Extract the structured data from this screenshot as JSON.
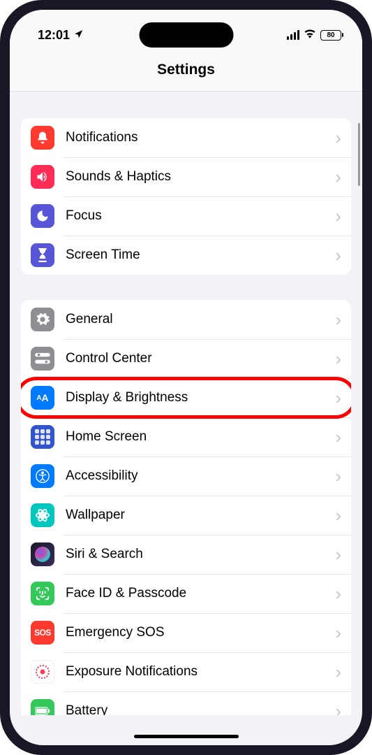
{
  "statusBar": {
    "time": "12:01",
    "battery": "80"
  },
  "header": {
    "title": "Settings"
  },
  "sections": [
    {
      "items": [
        {
          "key": "notifications",
          "label": "Notifications"
        },
        {
          "key": "sounds",
          "label": "Sounds & Haptics"
        },
        {
          "key": "focus",
          "label": "Focus"
        },
        {
          "key": "screentime",
          "label": "Screen Time"
        }
      ]
    },
    {
      "items": [
        {
          "key": "general",
          "label": "General"
        },
        {
          "key": "control",
          "label": "Control Center"
        },
        {
          "key": "display",
          "label": "Display & Brightness",
          "highlighted": true
        },
        {
          "key": "home",
          "label": "Home Screen"
        },
        {
          "key": "accessibility",
          "label": "Accessibility"
        },
        {
          "key": "wallpaper",
          "label": "Wallpaper"
        },
        {
          "key": "siri",
          "label": "Siri & Search"
        },
        {
          "key": "faceid",
          "label": "Face ID & Passcode"
        },
        {
          "key": "sos",
          "label": "Emergency SOS"
        },
        {
          "key": "exposure",
          "label": "Exposure Notifications"
        },
        {
          "key": "battery",
          "label": "Battery"
        }
      ]
    }
  ],
  "annotation": {
    "highlight_color": "#ff0000"
  }
}
